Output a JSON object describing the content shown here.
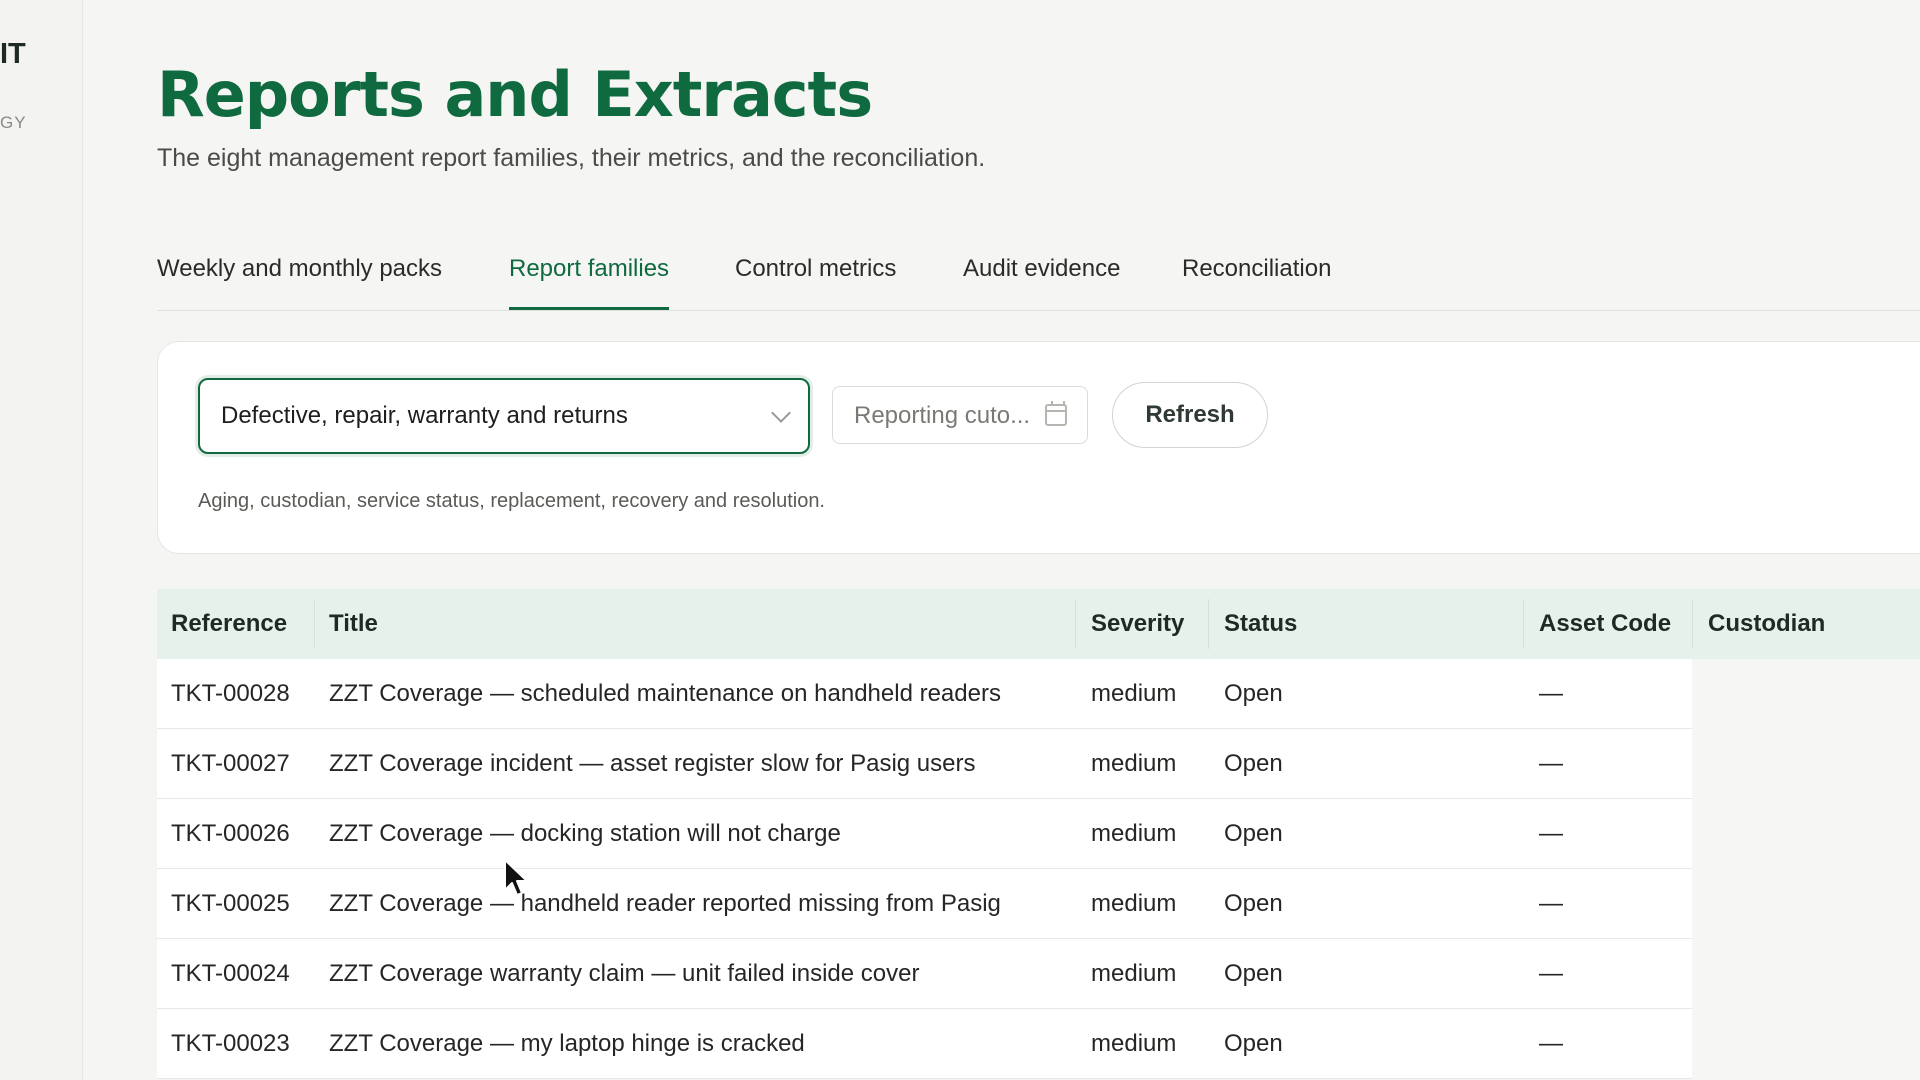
{
  "sidebar": {
    "brand_name": "IT",
    "brand_sub": "GY"
  },
  "page": {
    "title": "Reports and Extracts",
    "subtitle": "The eight management report families, their metrics, and the reconciliation."
  },
  "tabs": [
    {
      "label": "Weekly and monthly packs",
      "active": false
    },
    {
      "label": "Report families",
      "active": true
    },
    {
      "label": "Control metrics",
      "active": false
    },
    {
      "label": "Audit evidence",
      "active": false
    },
    {
      "label": "Reconciliation",
      "active": false
    }
  ],
  "filters": {
    "family_select": {
      "value": "Defective, repair, warranty and returns",
      "icon": "chevron-down-icon"
    },
    "date": {
      "value": "Reporting cuto...",
      "icon": "calendar-icon"
    },
    "refresh_label": "Refresh",
    "description": "Aging, custodian, service status, replacement, recovery and resolution."
  },
  "table": {
    "headers": [
      "Reference",
      "Title",
      "Severity",
      "Status",
      "Asset Code",
      "Custodian"
    ],
    "rows": [
      {
        "reference": "TKT-00028",
        "title": "ZZT Coverage — scheduled maintenance on handheld readers",
        "severity": "medium",
        "status": "Open",
        "asset_code": "—"
      },
      {
        "reference": "TKT-00027",
        "title": "ZZT Coverage incident — asset register slow for Pasig users",
        "severity": "medium",
        "status": "Open",
        "asset_code": "—"
      },
      {
        "reference": "TKT-00026",
        "title": "ZZT Coverage — docking station will not charge",
        "severity": "medium",
        "status": "Open",
        "asset_code": "—"
      },
      {
        "reference": "TKT-00025",
        "title": "ZZT Coverage — handheld reader reported missing from Pasig",
        "severity": "medium",
        "status": "Open",
        "asset_code": "—"
      },
      {
        "reference": "TKT-00024",
        "title": "ZZT Coverage warranty claim — unit failed inside cover",
        "severity": "medium",
        "status": "Open",
        "asset_code": "—"
      },
      {
        "reference": "TKT-00023",
        "title": "ZZT Coverage — my laptop hinge is cracked",
        "severity": "medium",
        "status": "Open",
        "asset_code": "—"
      }
    ]
  },
  "colors": {
    "accent": "#0f6a40",
    "table_header_bg": "#e7f1ec",
    "page_bg": "#f5f5f3"
  }
}
